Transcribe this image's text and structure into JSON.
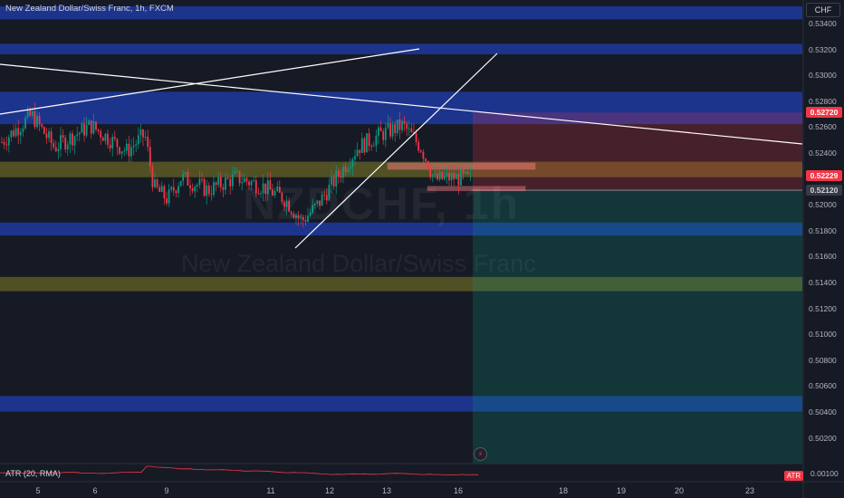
{
  "symbol": {
    "title": "New Zealand Dollar/Swiss Franc, 1h, FXCM",
    "watermark_ticker": "NZDCHF, 1h",
    "watermark_name": "New Zealand Dollar/Swiss Franc",
    "currency": "CHF"
  },
  "price_axis": {
    "ticks": [
      "0.53400",
      "0.53200",
      "0.53000",
      "0.52800",
      "0.52600",
      "0.52400",
      "0.52000",
      "0.51800",
      "0.51600",
      "0.51400",
      "0.51200",
      "0.51000",
      "0.50800",
      "0.50600",
      "0.50400",
      "0.50200"
    ],
    "tick_values": [
      0.534,
      0.532,
      0.53,
      0.528,
      0.526,
      0.524,
      0.52,
      0.518,
      0.516,
      0.514,
      0.512,
      0.51,
      0.508,
      0.506,
      0.504,
      0.502
    ],
    "badges": [
      {
        "label": "0.52720",
        "value": 0.5272,
        "bg": "#f23645",
        "fg": "#ffffff"
      },
      {
        "label": "0.52229",
        "value": 0.52229,
        "bg": "#f23645",
        "fg": "#ffffff"
      },
      {
        "label": "0.52120",
        "value": 0.5212,
        "bg": "#363a45",
        "fg": "#d1d4dc"
      }
    ]
  },
  "time_axis": {
    "labels": [
      {
        "label": "5",
        "day": 5
      },
      {
        "label": "6",
        "day": 6
      },
      {
        "label": "9",
        "day": 9
      },
      {
        "label": "11",
        "day": 11
      },
      {
        "label": "12",
        "day": 12
      },
      {
        "label": "13",
        "day": 13
      },
      {
        "label": "16",
        "day": 16
      },
      {
        "label": "18",
        "day": 18
      },
      {
        "label": "19",
        "day": 19
      },
      {
        "label": "20",
        "day": 20
      },
      {
        "label": "23",
        "day": 23
      }
    ]
  },
  "zones": [
    {
      "name": "blue-zone-top",
      "from": 0.5354,
      "to": 0.5344,
      "color": "#1e3aa0"
    },
    {
      "name": "blue-zone-1",
      "from": 0.5325,
      "to": 0.5317,
      "color": "#1e3aa0"
    },
    {
      "name": "blue-zone-2",
      "from": 0.5288,
      "to": 0.5263,
      "color": "#1e3aa0"
    },
    {
      "name": "yellow-zone-1",
      "from": 0.5234,
      "to": 0.5222,
      "color": "#5c5a24"
    },
    {
      "name": "blue-zone-3",
      "from": 0.5187,
      "to": 0.5177,
      "color": "#1e3aa0"
    },
    {
      "name": "yellow-zone-2",
      "from": 0.5145,
      "to": 0.5134,
      "color": "#5c5a24"
    },
    {
      "name": "blue-zone-4",
      "from": 0.5053,
      "to": 0.5041,
      "color": "#1e3aa0"
    }
  ],
  "position": {
    "entry": 0.5212,
    "stop": 0.5272,
    "target": 0.5,
    "stop_color": "#f23645",
    "target_color": "#089981"
  },
  "atr": {
    "label": "ATR (20, RMA)",
    "badge": "ATR",
    "value": "0.00100"
  },
  "colors": {
    "background": "#161a25",
    "up_candle": "#089981",
    "down_candle": "#f23645",
    "trendline": "#ffffff"
  }
}
